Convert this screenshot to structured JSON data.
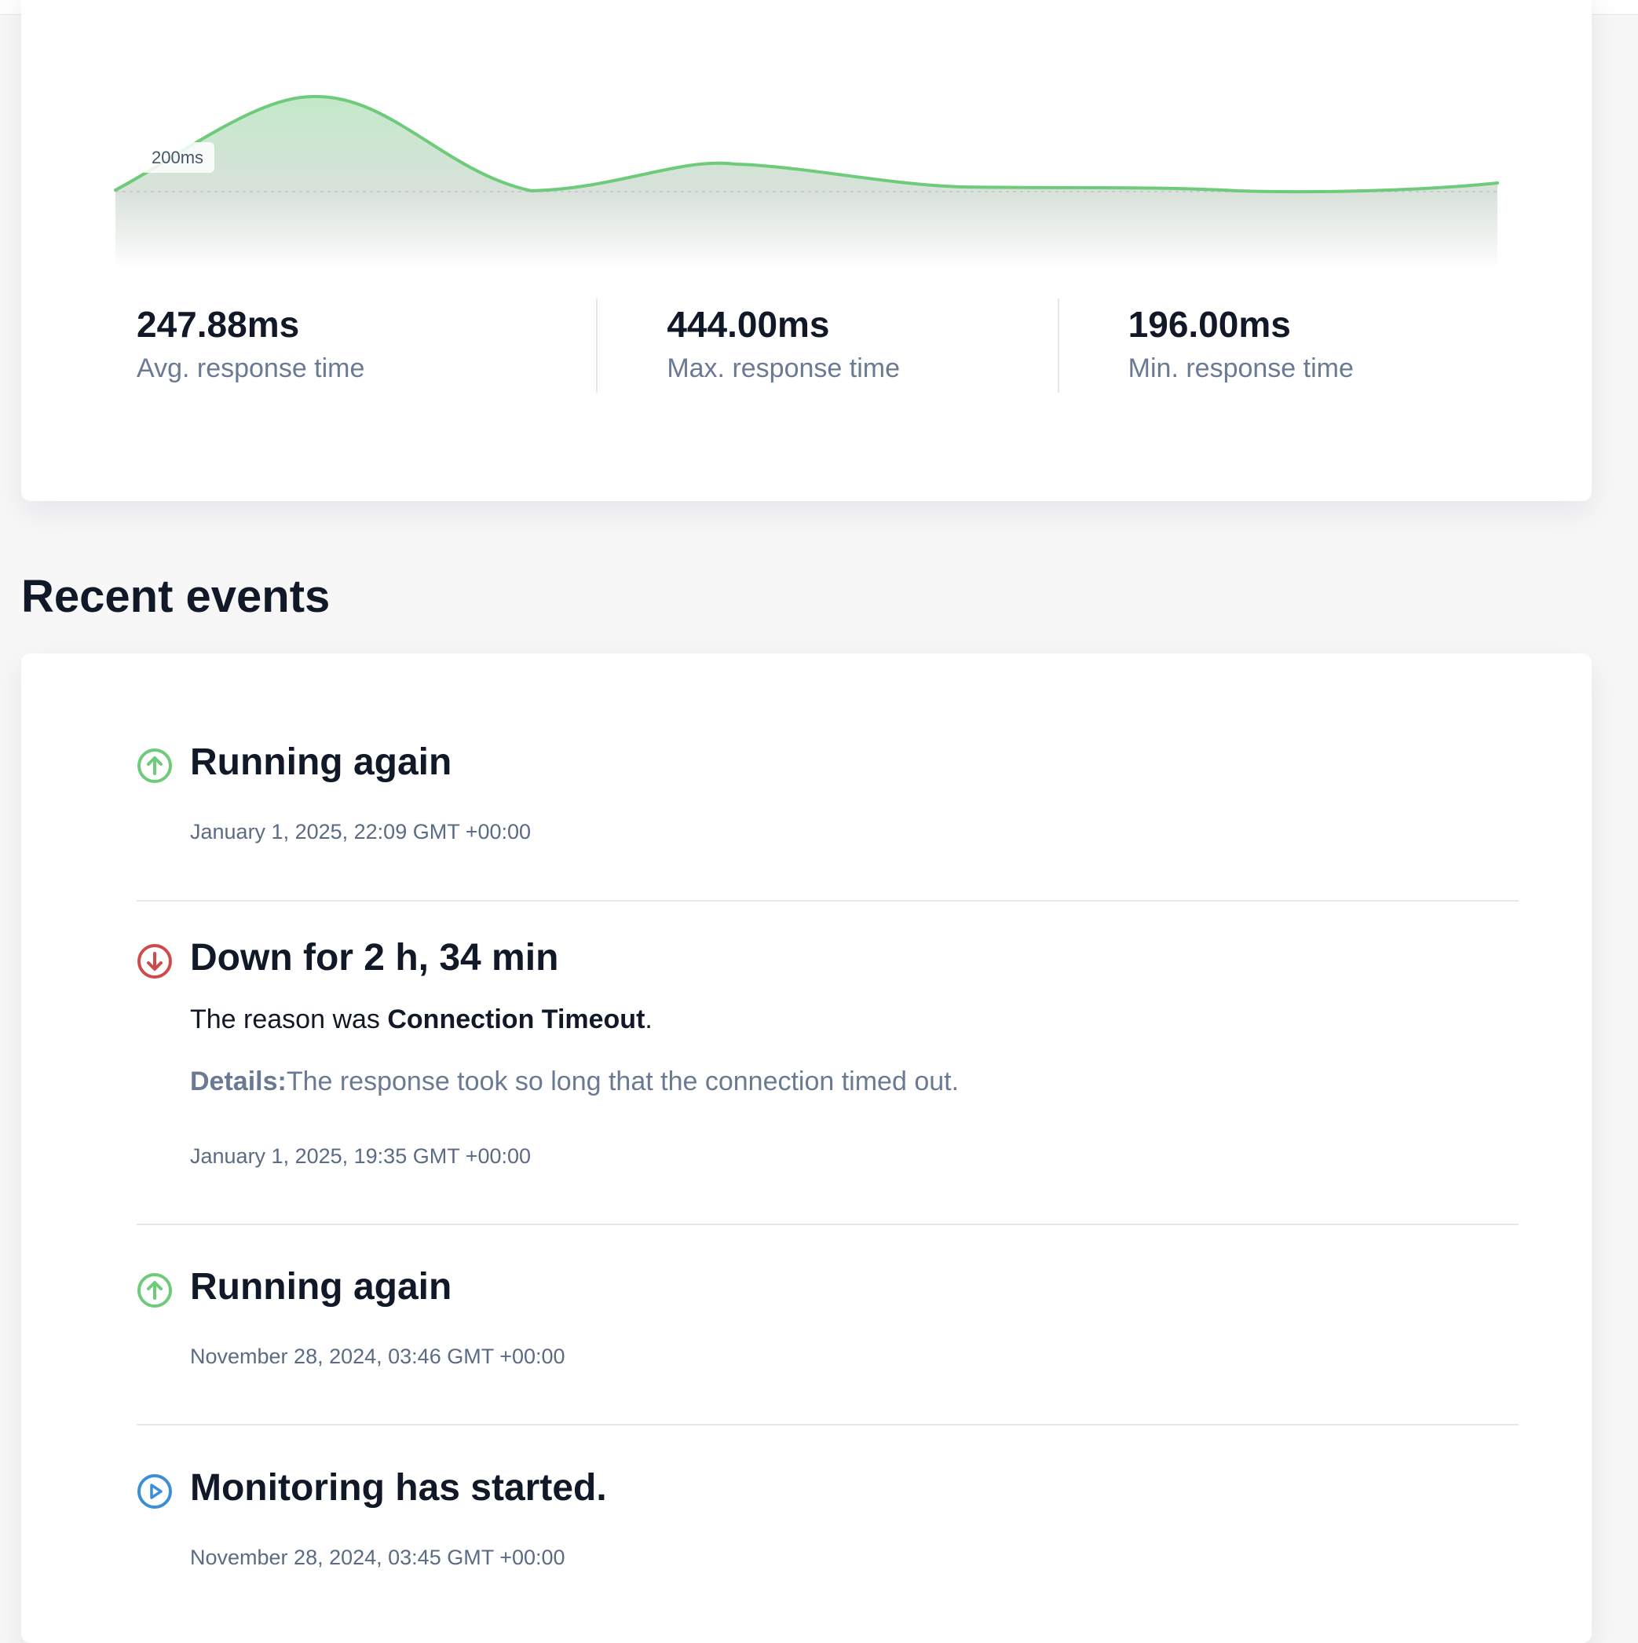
{
  "chart_data": {
    "type": "area",
    "threshold_label": "200ms",
    "colors": {
      "line": "#6dcb7a",
      "fill_top": "#c9ecd0",
      "fill_bottom": "#ffffff"
    }
  },
  "stats": [
    {
      "value": "247.88ms",
      "label": "Avg. response time"
    },
    {
      "value": "444.00ms",
      "label": "Max. response time"
    },
    {
      "value": "196.00ms",
      "label": "Min. response time"
    }
  ],
  "events_section": {
    "title": "Recent events",
    "items": [
      {
        "icon": "arrow-up-circle-icon",
        "color": "#6dcb7a",
        "title": "Running again",
        "time": "January 1, 2025, 22:09 GMT +00:00"
      },
      {
        "icon": "arrow-down-circle-icon",
        "color": "#cf4b4b",
        "title": "Down for 2 h, 34 min",
        "reason_prefix": "The reason was ",
        "reason": "Connection Timeout",
        "reason_suffix": ".",
        "details_label": "Details:",
        "details": "The response took so long that the connection timed out.",
        "time": "January 1, 2025, 19:35 GMT +00:00"
      },
      {
        "icon": "arrow-up-circle-icon",
        "color": "#6dcb7a",
        "title": "Running again",
        "time": "November 28, 2024, 03:46 GMT +00:00"
      },
      {
        "icon": "play-circle-icon",
        "color": "#3b8fd6",
        "title": "Monitoring has started.",
        "time": "November 28, 2024, 03:45 GMT +00:00"
      }
    ]
  }
}
